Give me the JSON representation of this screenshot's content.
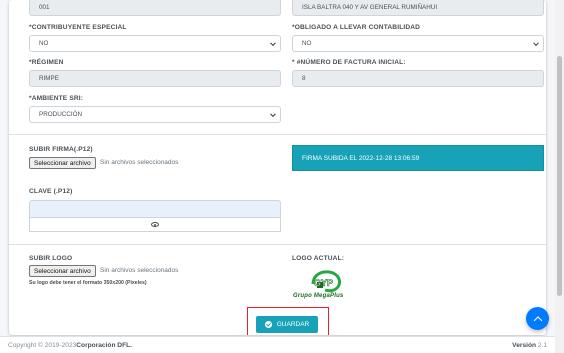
{
  "form": {
    "establecimiento_value": "001",
    "direccion_value": "ISLA BALTRA 040 Y AV GENERAL RUMIÑAHUI",
    "contribuyente_label": "*CONTRIBUYENTE ESPECIAL",
    "contribuyente_value": "NO",
    "obligado_label": "*OBLIGADO A LLEVAR CONTABILIDAD",
    "obligado_value": "NO",
    "regimen_label": "*RÉGIMEN",
    "regimen_value": "RIMPE",
    "factura_label": "* #NÚMERO DE FACTURA INICIAL:",
    "factura_value": "8",
    "ambiente_label": "*AMBIENTE SRI:",
    "ambiente_value": "PRODUCCIÓN",
    "firma_label": "SUBIR FIRMA(.P12)",
    "firma_button": "Seleccionar archivo",
    "firma_status": "Sin archivos seleccionados",
    "firma_info": "FIRMA SUBIDA EL 2022-12-28 13:06:59",
    "clave_label": "CLAVE (.P12)",
    "clave_value": "",
    "logo_label": "SUBIR LOGO",
    "logo_button": "Seleccionar archivo",
    "logo_status": "Sin archivos seleccionados",
    "logo_hint": "Su logo debe tener el formato 350x200 (Pixeles)",
    "logo_actual_label": "LOGO ACTUAL:",
    "logo_text": "Grupo MegaPlus",
    "save_label": "GUARDAR"
  },
  "footer": {
    "copyright_prefix": "Copyright © 2019-2023 ",
    "company": "Corporación DFL.",
    "version_label": "Versión",
    "version_value": "2.1"
  },
  "colors": {
    "accent": "#17a2b8",
    "fab": "#007bff",
    "highlight": "#e02424",
    "logo_green": "#1c6b22"
  },
  "icons": [
    "chevron-down-icon",
    "eye-icon",
    "check-circle-icon",
    "arrow-up-icon"
  ]
}
